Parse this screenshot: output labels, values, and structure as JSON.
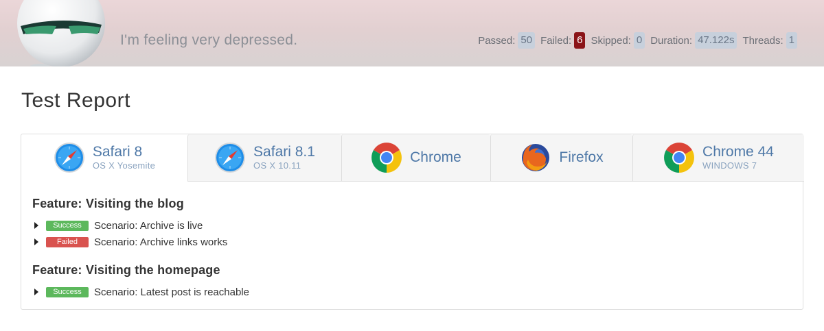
{
  "header": {
    "tagline": "I'm feeling very depressed.",
    "stats": [
      {
        "label": "Passed:",
        "value": "50",
        "status": "neutral"
      },
      {
        "label": "Failed:",
        "value": "6",
        "status": "danger"
      },
      {
        "label": "Skipped:",
        "value": "0",
        "status": "neutral"
      },
      {
        "label": "Duration:",
        "value": "47.122s",
        "status": "neutral"
      },
      {
        "label": "Threads:",
        "value": "1",
        "status": "neutral"
      }
    ]
  },
  "page": {
    "title": "Test Report"
  },
  "tabs": [
    {
      "name": "Safari 8",
      "os": "OS X Yosemite",
      "icon": "safari-icon",
      "active": true
    },
    {
      "name": "Safari 8.1",
      "os": "OS X 10.11",
      "icon": "safari-icon",
      "active": false
    },
    {
      "name": "Chrome",
      "os": "",
      "icon": "chrome-icon",
      "active": false
    },
    {
      "name": "Firefox",
      "os": "",
      "icon": "firefox-icon",
      "active": false
    },
    {
      "name": "Chrome 44",
      "os": "WINDOWS 7",
      "icon": "chrome-icon",
      "active": false
    }
  ],
  "features": [
    {
      "title": "Feature: Visiting the blog",
      "scenarios": [
        {
          "status": "Success",
          "text": "Scenario: Archive is live"
        },
        {
          "status": "Failed",
          "text": "Scenario: Archive links works"
        }
      ]
    },
    {
      "title": "Feature: Visiting the homepage",
      "scenarios": [
        {
          "status": "Success",
          "text": "Scenario: Latest post is reachable"
        }
      ]
    }
  ],
  "colors": {
    "success": "#5cb85c",
    "failed": "#d9534f",
    "danger_badge": "#8b1418",
    "tab_text": "#4e78a7"
  }
}
